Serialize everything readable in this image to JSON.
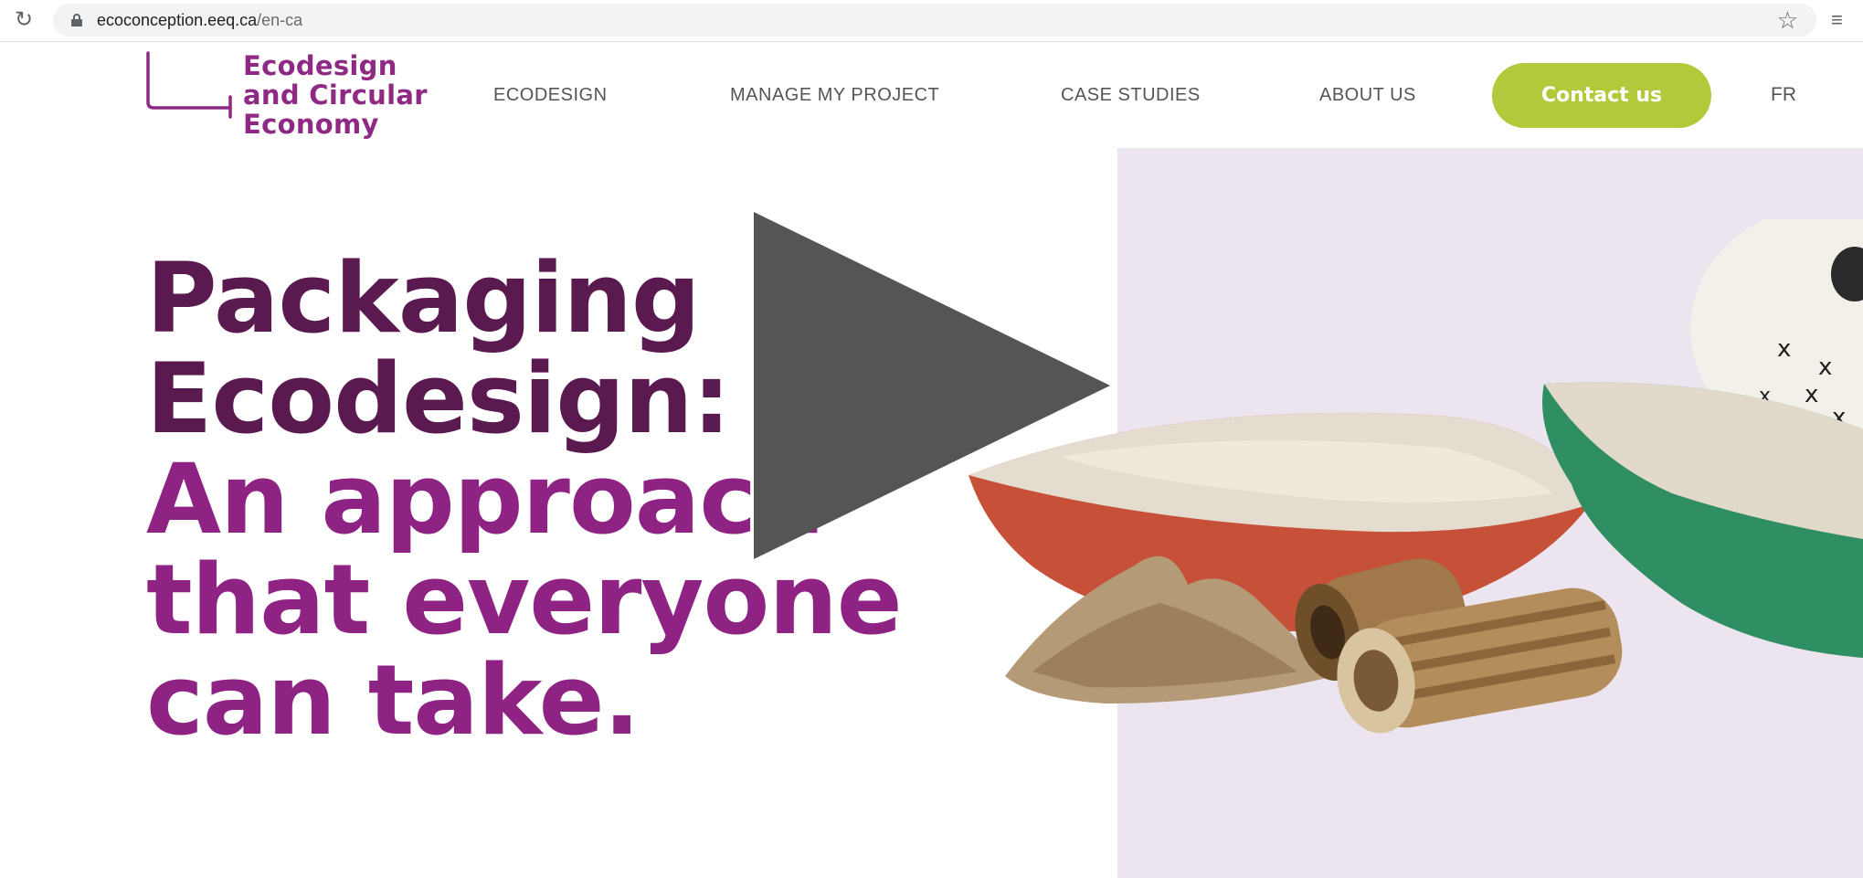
{
  "browser": {
    "reload_icon": "reload-icon",
    "lock_icon": "lock-icon",
    "url_domain": "ecoconception.eeq.ca",
    "url_path": "/en-ca",
    "bookmark_icon": "star-icon",
    "media_icon": "media-control-icon"
  },
  "header": {
    "logo_text": "Ecodesign\nand Circular\nEconomy",
    "nav": [
      "ECODESIGN",
      "MANAGE MY PROJECT",
      "CASE STUDIES",
      "ABOUT US"
    ],
    "contact_label": "Contact us",
    "language_label": "FR"
  },
  "hero": {
    "line1": "Packaging",
    "line2": "Ecodesign:",
    "line3": "An approach",
    "line4": "that everyone",
    "line5": "can take."
  },
  "overlay": {
    "play_icon": "play-icon"
  },
  "colors": {
    "brand_purple": "#8e2384",
    "dark_purple": "#5a1a4f",
    "accent_green": "#b3c83a",
    "panel_lavender": "#ece4ef",
    "play_gray": "#555555"
  }
}
